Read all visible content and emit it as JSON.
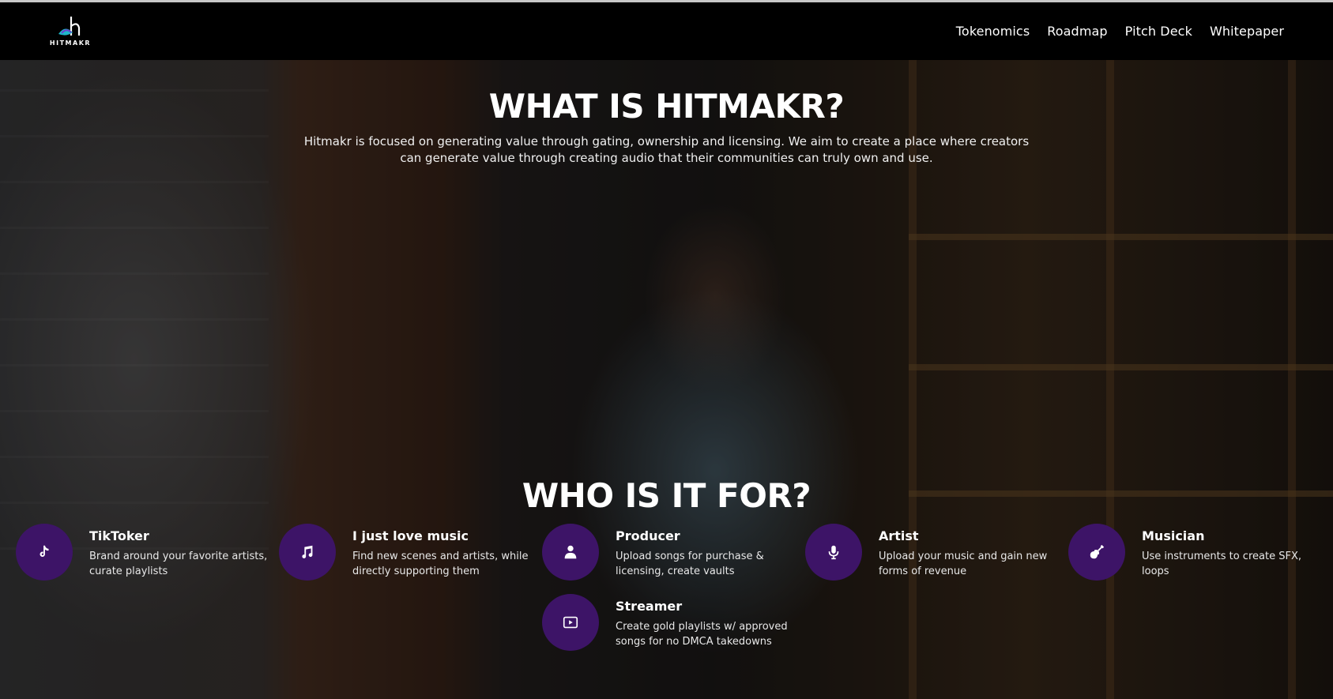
{
  "brand": {
    "name": "HITMAKR"
  },
  "nav": {
    "items": [
      {
        "label": "Tokenomics"
      },
      {
        "label": "Roadmap"
      },
      {
        "label": "Pitch Deck"
      },
      {
        "label": "Whitepaper"
      }
    ]
  },
  "hero": {
    "title": "WHAT IS HITMAKR?",
    "intro": "Hitmakr is focused on generating value through gating, ownership and licensing. We aim to create a place where creators can generate value through creating audio that their communities can truly own and use."
  },
  "audience": {
    "title": "WHO IS IT FOR?",
    "cards": [
      {
        "icon": "tiktok-icon",
        "title": "TikToker",
        "desc": "Brand around your favorite artists, curate playlists"
      },
      {
        "icon": "music-note-icon",
        "title": "I just love music",
        "desc": "Find new scenes and artists, while directly supporting them"
      },
      {
        "icon": "user-icon",
        "title": "Producer",
        "desc": "Upload songs for purchase & licensing, create vaults"
      },
      {
        "icon": "microphone-icon",
        "title": "Artist",
        "desc": "Upload your music and gain new forms of revenue"
      },
      {
        "icon": "guitar-icon",
        "title": "Musician",
        "desc": "Use instruments to create SFX, loops"
      },
      {
        "icon": "play-screen-icon",
        "title": "Streamer",
        "desc": "Create gold playlists w/ approved songs for no DMCA takedowns"
      }
    ]
  },
  "colors": {
    "header_bg": "#000000",
    "badge_bg": "#3d1467",
    "text": "#ffffff"
  }
}
